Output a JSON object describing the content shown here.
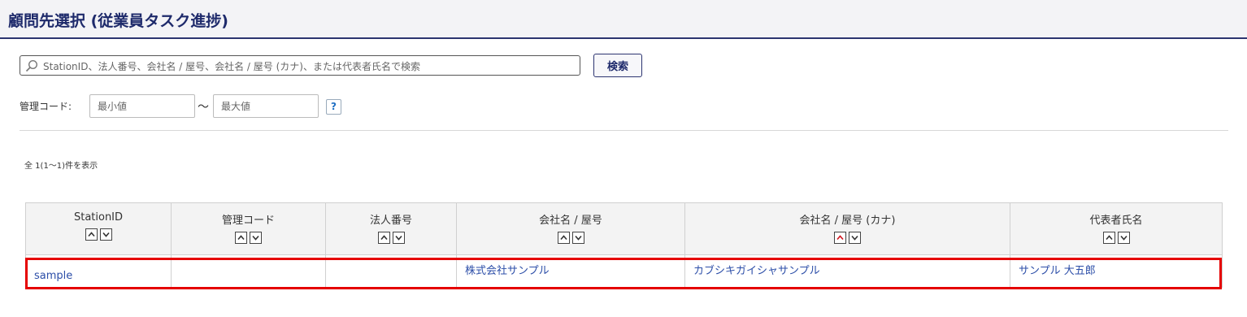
{
  "header": {
    "title": "顧問先選択 (従業員タスク進捗)"
  },
  "search": {
    "placeholder": "StationID、法人番号、会社名 / 屋号、会社名 / 屋号 (カナ)、または代表者氏名で検索",
    "value": "",
    "button_label": "検索"
  },
  "code_filter": {
    "label": "管理コード:",
    "min_placeholder": "最小値",
    "separator": "〜",
    "max_placeholder": "最大値",
    "help_label": "?"
  },
  "result_count": "全 1(1〜1)件を表示",
  "table": {
    "columns": [
      {
        "label": "StationID"
      },
      {
        "label": "管理コード"
      },
      {
        "label": "法人番号"
      },
      {
        "label": "会社名 / 屋号"
      },
      {
        "label": "会社名 / 屋号 (カナ)"
      },
      {
        "label": "代表者氏名"
      }
    ],
    "rows": [
      {
        "station_id": "sample",
        "code": "",
        "corp_number": "",
        "company": "株式会社サンプル",
        "company_kana": "カブシキガイシャサンプル",
        "representative": "サンプル 大五郎"
      }
    ]
  },
  "colors": {
    "title": "#1e2a6b",
    "link": "#2c4ea8",
    "highlight": "#e50000",
    "active_sort": "#d0141e"
  },
  "icons": {
    "search": "search-icon",
    "sort_up": "chevron-up-icon",
    "sort_down": "chevron-down-icon"
  }
}
